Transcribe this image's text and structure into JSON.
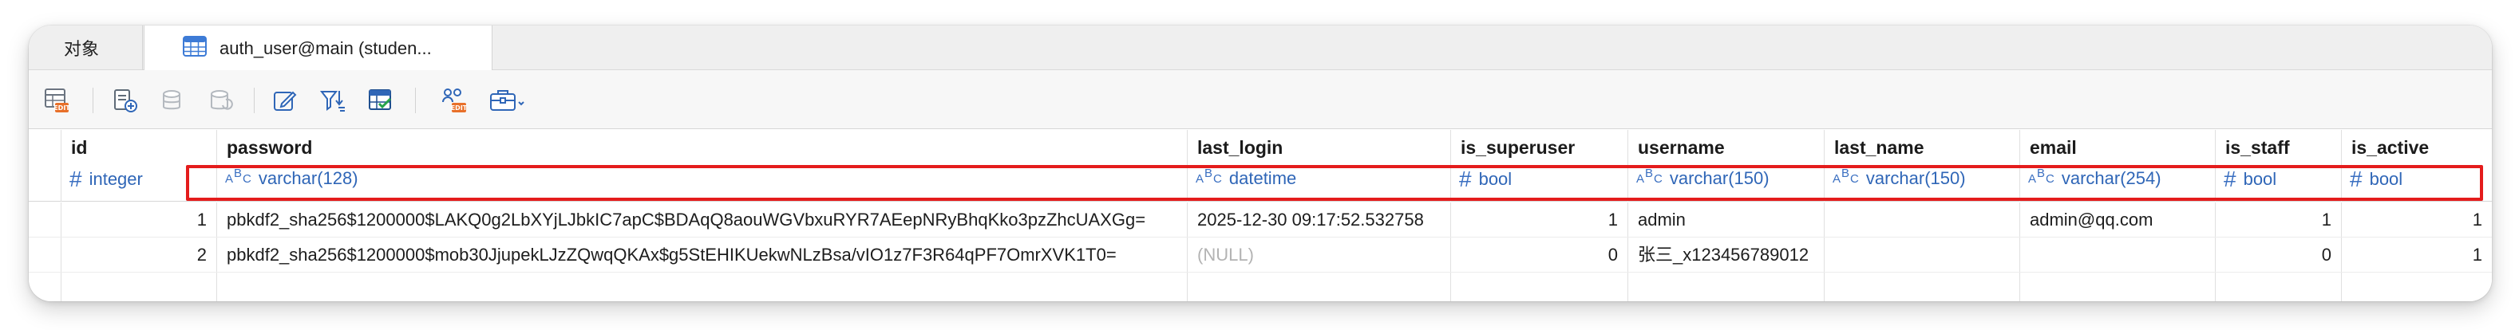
{
  "tabs": [
    {
      "label": "对象",
      "active": false
    },
    {
      "label": "auth_user@main (studen...",
      "active": true
    }
  ],
  "toolbar": {
    "items": [
      "table-edit-icon",
      "add-record-icon",
      "delete-record-icon",
      "refresh-icon",
      "edit-icon",
      "filter-sort-icon",
      "grid-view-icon",
      "export-icon",
      "more-tools-icon"
    ]
  },
  "columns": [
    {
      "name": "id",
      "type": "integer",
      "type_icon": "#"
    },
    {
      "name": "password",
      "type": "varchar(128)",
      "type_icon": "abc"
    },
    {
      "name": "last_login",
      "type": "datetime",
      "type_icon": "abc"
    },
    {
      "name": "is_superuser",
      "type": "bool",
      "type_icon": "#"
    },
    {
      "name": "username",
      "type": "varchar(150)",
      "type_icon": "abc"
    },
    {
      "name": "last_name",
      "type": "varchar(150)",
      "type_icon": "abc"
    },
    {
      "name": "email",
      "type": "varchar(254)",
      "type_icon": "abc"
    },
    {
      "name": "is_staff",
      "type": "bool",
      "type_icon": "#"
    },
    {
      "name": "is_active",
      "type": "bool",
      "type_icon": "#"
    }
  ],
  "rows": [
    [
      "1",
      "pbkdf2_sha256$1200000$LAKQ0g2LbXYjLJbkIC7apC$BDAqQ8aouWGVbxuRYR7AEepNRyBhqKko3pzZhcUAXGg=",
      "2025-12-30 09:17:52.532758",
      "1",
      "admin",
      "",
      "admin@qq.com",
      "1",
      "1"
    ],
    [
      "2",
      "pbkdf2_sha256$1200000$mob30JjupekLJzZQwqQKAx$g5StEHIKUekwNLzBsa/vIO1z7F3R64qPF7OmrXVK1T0=",
      "(NULL)",
      "0",
      "张三_x123456789012",
      "",
      "",
      "0",
      "1"
    ]
  ],
  "colors": {
    "type_blue": "#2f66b7",
    "highlight_red": "#e41c1c",
    "null_gray": "#b3b3b3"
  }
}
